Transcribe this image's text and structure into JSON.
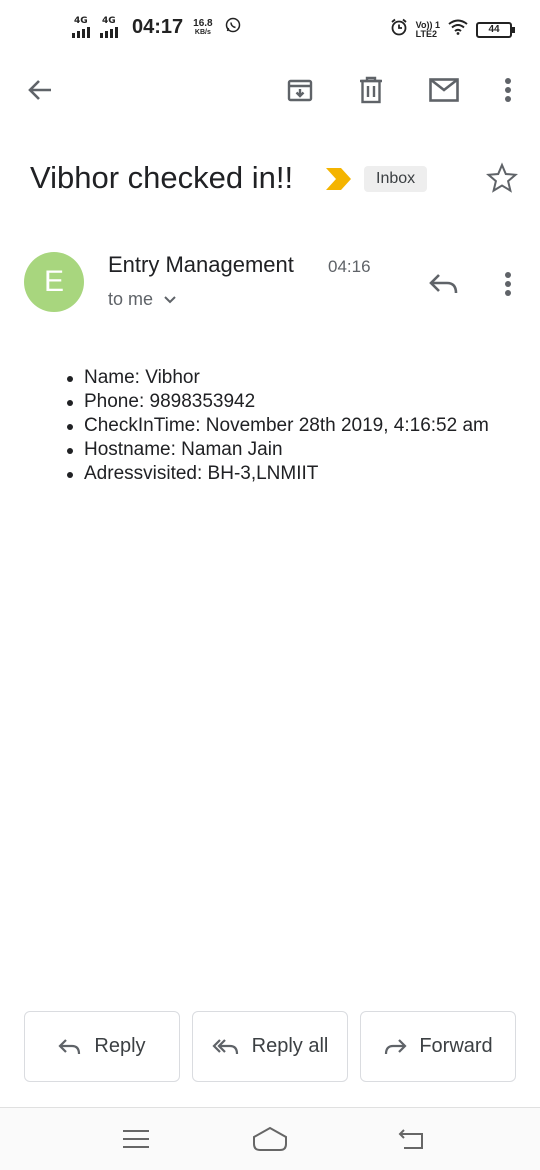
{
  "status_bar": {
    "net1": "4G",
    "net2": "4G",
    "time": "04:17",
    "speed_value": "16.8",
    "speed_unit": "KB/s",
    "volte_line1": "Vo)) 1",
    "volte_line2": "LTE2",
    "battery": "44",
    "icons": [
      "whatsapp-icon",
      "alarm-icon",
      "wifi-icon",
      "battery-icon"
    ]
  },
  "toolbar": {
    "icons": [
      "back-arrow-icon",
      "archive-icon",
      "delete-icon",
      "mark-unread-icon",
      "more-vert-icon"
    ]
  },
  "email": {
    "subject": "Vibhor checked in!!",
    "label": "Inbox",
    "sender_initial": "E",
    "sender_name": "Entry Management",
    "time": "04:16",
    "recipient": "to me",
    "body_items": [
      "Name: Vibhor",
      "Phone: 9898353942",
      "CheckInTime: November 28th 2019, 4:16:52 am",
      "Hostname: Naman Jain",
      "Adressvisited: BH-3,LNMIIT"
    ]
  },
  "actions": {
    "reply": "Reply",
    "reply_all": "Reply all",
    "forward": "Forward"
  },
  "colors": {
    "avatar": "#a8d67e",
    "importance": "#f4b400",
    "icon": "#5f6368"
  }
}
